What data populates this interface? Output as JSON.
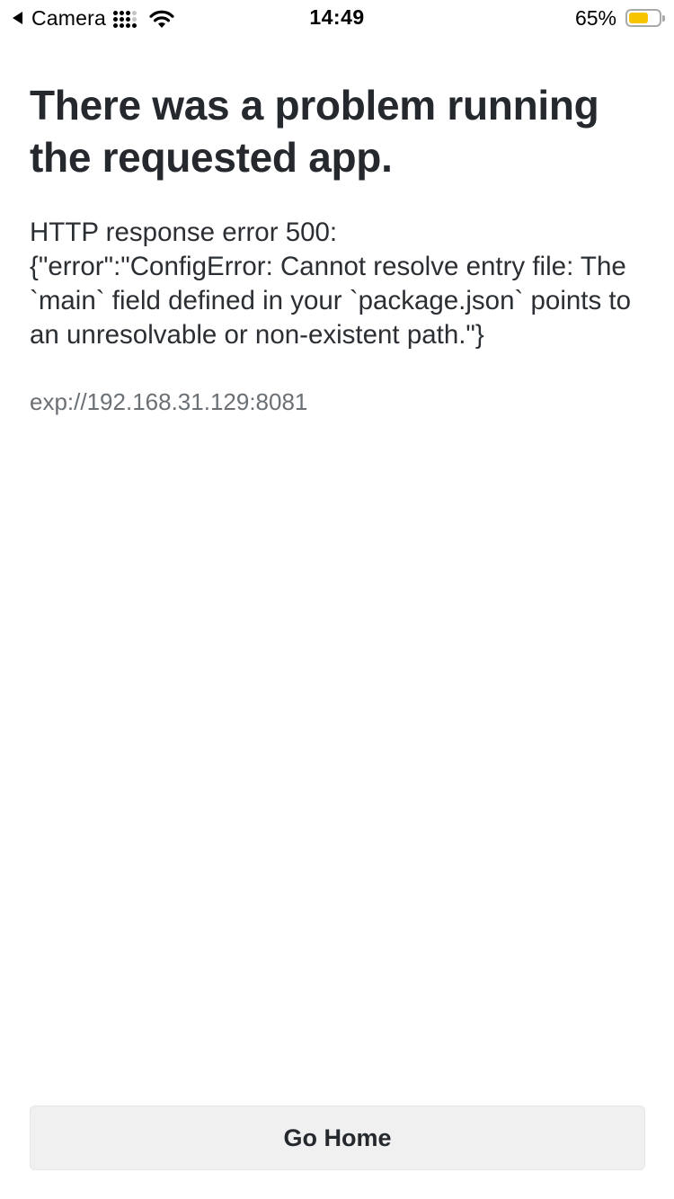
{
  "status_bar": {
    "back_label": "Camera",
    "time": "14:49",
    "battery_percent_label": "65%",
    "battery_level": 0.65,
    "battery_color": "#f6c400",
    "icons": [
      "back-arrow-icon",
      "signal-strength-icon",
      "wifi-icon",
      "battery-icon"
    ]
  },
  "error": {
    "title": "There was a problem running the requested app.",
    "message": "HTTP response error 500:\n{\"error\":\"ConfigError: Cannot resolve entry file: The `main` field defined in your `package.json` points to an unresolvable or non-existent path.\"}",
    "url": "exp://192.168.31.129:8081"
  },
  "actions": {
    "go_home_label": "Go Home"
  }
}
